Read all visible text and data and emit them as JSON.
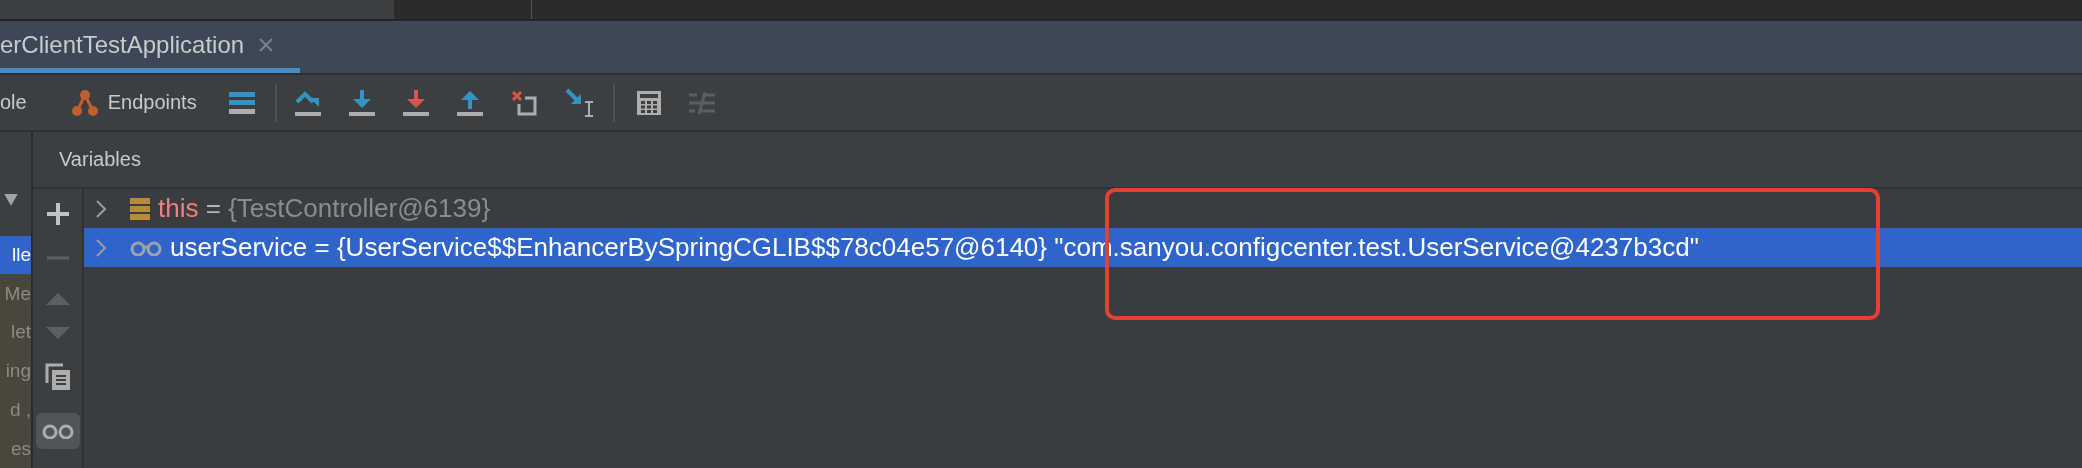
{
  "run_tab": {
    "label": "erClientTestApplication",
    "selected": true
  },
  "toolbar": {
    "console_tab": "ole",
    "endpoints_tab": "Endpoints"
  },
  "frames": [
    {
      "label": "lle",
      "selected": true
    },
    {
      "label": "Me",
      "selected": false
    },
    {
      "label": "let",
      "selected": false
    },
    {
      "label": "ing",
      "selected": false
    },
    {
      "label": "d ,",
      "selected": false
    },
    {
      "label": "es",
      "selected": false
    }
  ],
  "variables": {
    "title": "Variables",
    "rows": [
      {
        "kind": "field",
        "name": "this",
        "operator": "=",
        "value": "{TestController@6139}",
        "selected": false,
        "expanded": false
      },
      {
        "kind": "watch",
        "name": "userService",
        "operator": "=",
        "value": "{UserService$$EnhancerBySpringCGLIB$$78c04e57@6140}",
        "string": "\"com.sanyou.configcenter.test.UserService@4237b3cd\"",
        "selected": true,
        "expanded": false
      }
    ]
  }
}
